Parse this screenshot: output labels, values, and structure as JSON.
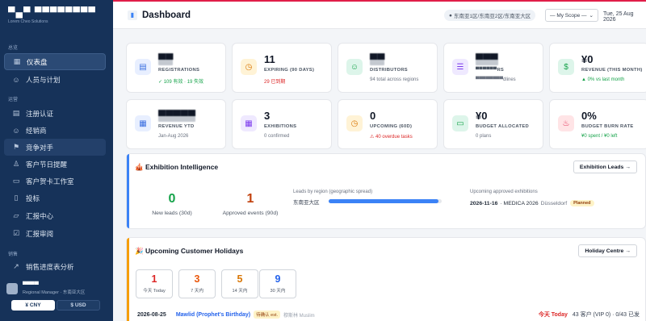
{
  "sidebar": {
    "logo": "▀▄▀ ▀▀▀▀▀▀▀▀",
    "logo_sub": "Lorem Cheo Solutions",
    "section_overview": "总览",
    "section_ops": "运营",
    "section_sales": "销售",
    "items": [
      {
        "label": "仪表盘",
        "icon": "grid"
      },
      {
        "label": "人员与计划",
        "icon": "user"
      },
      {
        "label": "注册认证",
        "icon": "doc"
      },
      {
        "label": "经销商",
        "icon": "user-plus"
      },
      {
        "label": "竞争对手",
        "icon": "flag"
      },
      {
        "label": "客户节日提醒",
        "icon": "bell"
      },
      {
        "label": "客户贺卡工作室",
        "icon": "card"
      },
      {
        "label": "投标",
        "icon": "file"
      },
      {
        "label": "汇报中心",
        "icon": "folder"
      },
      {
        "label": "汇报审阅",
        "icon": "check"
      },
      {
        "label": "销售进度表分析",
        "icon": "trend"
      }
    ],
    "user": {
      "name": "▀▀▀▀",
      "role": "Regional Manager · 东南亚大区"
    },
    "currency": {
      "cny": "¥ CNY",
      "usd": "$ USD"
    }
  },
  "header": {
    "title": "Dashboard",
    "region": "东南亚1区/东南亚2区/东南亚大区",
    "scope": "— My Scope —",
    "date": "Tue, 25 Aug 2026"
  },
  "cards_row1": [
    {
      "value": "▀▀",
      "label": "REGISTRATIONS",
      "sub": "✓ 109 有效 · 19 失效",
      "sub_color": "#16a34a",
      "icon": "doc",
      "icon_bg": "#e8efff",
      "icon_color": "#3b6fe0"
    },
    {
      "value": "11",
      "label": "EXPIRING (90 DAYS)",
      "sub": "29 已到期",
      "sub_color": "#dc2626",
      "icon": "clock",
      "icon_bg": "#fff3d6",
      "icon_color": "#d97706"
    },
    {
      "value": "▀▀",
      "label": "DISTRIBUTORS",
      "sub": "94 total across regions",
      "sub_color": "#6b7280",
      "icon": "users",
      "icon_bg": "#ddf5ea",
      "icon_color": "#16a34a"
    },
    {
      "value": "▀▀▀",
      "label": "▀▀▀▀▀▀RS",
      "sub": "▀▀▀▀▀▀▀▀dlines",
      "sub_color": "#6b7280",
      "icon": "list",
      "icon_bg": "#efe9ff",
      "icon_color": "#7c3aed"
    },
    {
      "value": "¥0",
      "label": "REVENUE (THIS MONTH)",
      "sub": "▲ 0% vs last month",
      "sub_color": "#16a34a",
      "icon": "dollar",
      "icon_bg": "#ddf5ea",
      "icon_color": "#16a34a"
    }
  ],
  "cards_row2": [
    {
      "value": "▀▀▀▀▀",
      "label": "REVENUE YTD",
      "sub": "Jan-Aug 2026",
      "sub_color": "#6b7280",
      "icon": "cal",
      "icon_bg": "#e8efff",
      "icon_color": "#3b6fe0"
    },
    {
      "value": "3",
      "label": "EXHIBITIONS",
      "sub": "0 confirmed",
      "sub_color": "#6b7280",
      "icon": "cal",
      "icon_bg": "#efe9ff",
      "icon_color": "#7c3aed"
    },
    {
      "value": "0",
      "label": "UPCOMING (60D)",
      "sub": "⚠ 40 overdue tasks",
      "sub_color": "#dc2626",
      "icon": "clock",
      "icon_bg": "#fff3d6",
      "icon_color": "#d97706"
    },
    {
      "value": "¥0",
      "label": "BUDGET ALLOCATED",
      "sub": "0 plans",
      "sub_color": "#6b7280",
      "icon": "wallet",
      "icon_bg": "#ddf5ea",
      "icon_color": "#16a34a"
    },
    {
      "value": "0%",
      "label": "BUDGET BURN RATE",
      "sub": "¥0 spent / ¥0 left",
      "sub_color": "#16a34a",
      "icon": "flame",
      "icon_bg": "#ffe4e6",
      "icon_color": "#e11d48"
    }
  ],
  "exhibition": {
    "title": "🎪 Exhibition Intelligence",
    "button": "Exhibition Leads →",
    "new_leads": "0",
    "new_leads_label": "New leads (30d)",
    "approved": "1",
    "approved_label": "Approved events (90d)",
    "leads_region_label": "Leads by region (geographic spread)",
    "region_name": "东南亚大区",
    "region_share": 0.97,
    "upcoming_label": "Upcoming approved exhibitions",
    "upcoming_date": "2026-11-16",
    "upcoming_name": "· MEDICA 2026",
    "upcoming_city": "Düsseldorf",
    "upcoming_status": "Planned"
  },
  "holidays": {
    "title": "🎉 Upcoming Customer Holidays",
    "button": "Holiday Centre →",
    "stats": [
      {
        "n": "1",
        "t": "今天 Today",
        "color": "#dc2626"
      },
      {
        "n": "3",
        "t": "7 天内",
        "color": "#ea580c"
      },
      {
        "n": "5",
        "t": "14 天内",
        "color": "#d97706"
      },
      {
        "n": "9",
        "t": "30 天内",
        "color": "#2563eb"
      }
    ],
    "row": {
      "date": "2026-08-25",
      "name": "Mawlid (Prophet's Birthday)",
      "badge": "待确认 est.",
      "meta": "穆斯林 Muslim",
      "today": "今天 Today",
      "customers": "43 客户 (VIP 0) · 0/43 已发"
    }
  }
}
